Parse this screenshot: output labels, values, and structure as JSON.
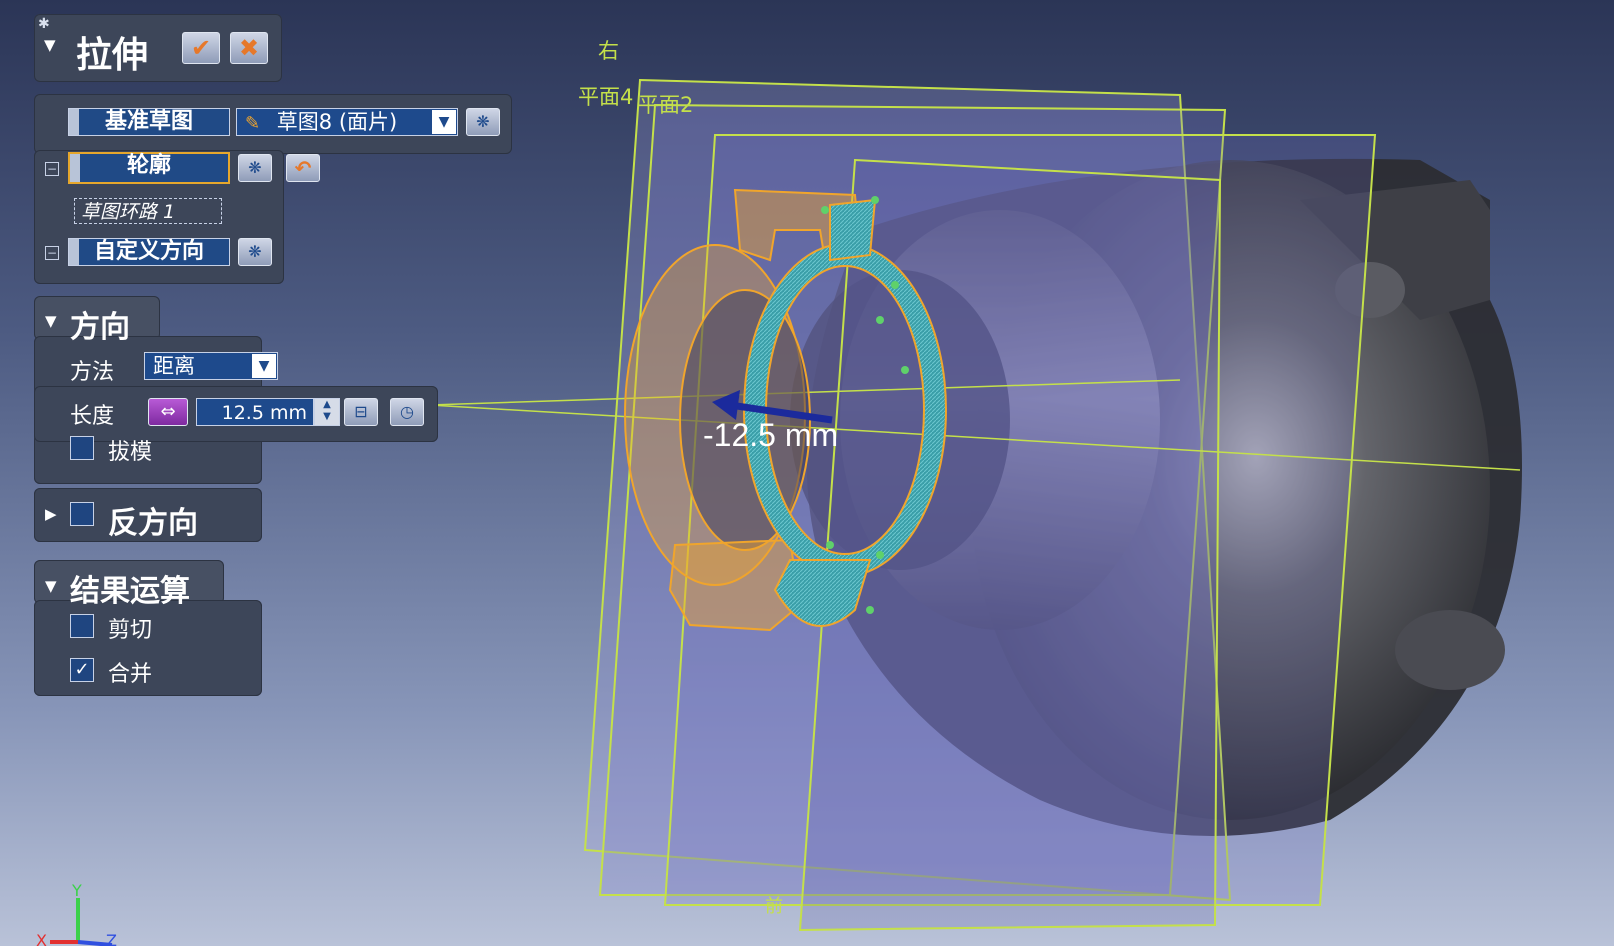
{
  "dialog": {
    "title": "拉伸",
    "ok_icon": "check-icon",
    "cancel_icon": "close-icon"
  },
  "inputs": {
    "base_sketch_label": "基准草图",
    "base_sketch_value": "草图8 (面片)",
    "profile_label": "轮廓",
    "profile_item": "草图环路 1",
    "custom_direction_label": "自定义方向"
  },
  "direction": {
    "header": "方向",
    "method_label": "方法",
    "method_value": "距离",
    "length_label": "长度",
    "length_value": "12.5 mm",
    "draft_label": "拔模",
    "draft_checked": false
  },
  "reverse": {
    "header": "反方向",
    "checked": false
  },
  "result": {
    "header": "结果运算",
    "cut_label": "剪切",
    "cut_checked": false,
    "merge_label": "合并",
    "merge_checked": true,
    "check_mark": "✓"
  },
  "viewport": {
    "dimension_label": "-12.5 mm",
    "plane_right": "右",
    "plane_4": "平面4",
    "plane_2": "平面2",
    "plane_front": "前",
    "axis_y": "Y",
    "axis_x": "X",
    "axis_z": "Z"
  },
  "colors": {
    "sketch_orange": "#f0a52c",
    "plane_green": "#c4e04a",
    "teal_face": "#3a9ea8",
    "field_blue": "#1e4a8c"
  }
}
